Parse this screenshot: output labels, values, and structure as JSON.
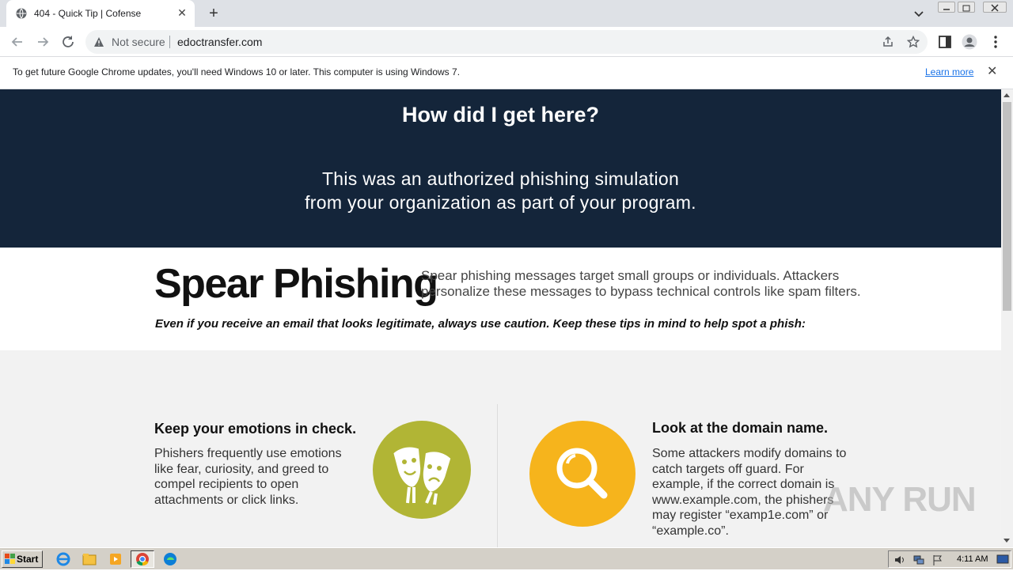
{
  "browser": {
    "tab_title": "404 - Quick Tip | Cofense",
    "new_tab_symbol": "+",
    "close_symbol": "✕",
    "security_label": "Not secure",
    "url": "edoctransfer.com"
  },
  "infobar": {
    "message": "To get future Google Chrome updates, you'll need Windows 10 or later. This computer is using Windows 7.",
    "link": "Learn more",
    "close_symbol": "✕"
  },
  "hero": {
    "title": "How did I get here?",
    "line1": "This was an authorized phishing simulation",
    "line2": "from your organization as part of your program."
  },
  "spear": {
    "title": "Spear Phishing",
    "description": "Spear phishing messages target small groups or individuals. Attackers personalize these messages to bypass technical controls like spam filters.",
    "tip": "Even if you receive an email that looks legitimate, always use caution. Keep these tips in mind to help spot a phish:"
  },
  "tips": [
    {
      "title": "Keep your emotions in check.",
      "body": "Phishers frequently use emotions like fear, curiosity, and greed to compel recipients to open attachments or click links.",
      "icon": "theater-masks-icon",
      "color": "#b1b535"
    },
    {
      "title": "Look at the domain name.",
      "body": "Some attackers modify domains to catch targets off guard. For example, if the correct domain is www.example.com, the phishers may register “examp1e.com” or “example.co”.",
      "icon": "magnifier-icon",
      "color": "#f6b41c"
    }
  ],
  "watermark": "ANY RUN",
  "taskbar": {
    "start_label": "Start",
    "clock": "4:11 AM"
  },
  "colors": {
    "hero_bg": "#14253a",
    "accent_link": "#1a73e8"
  }
}
